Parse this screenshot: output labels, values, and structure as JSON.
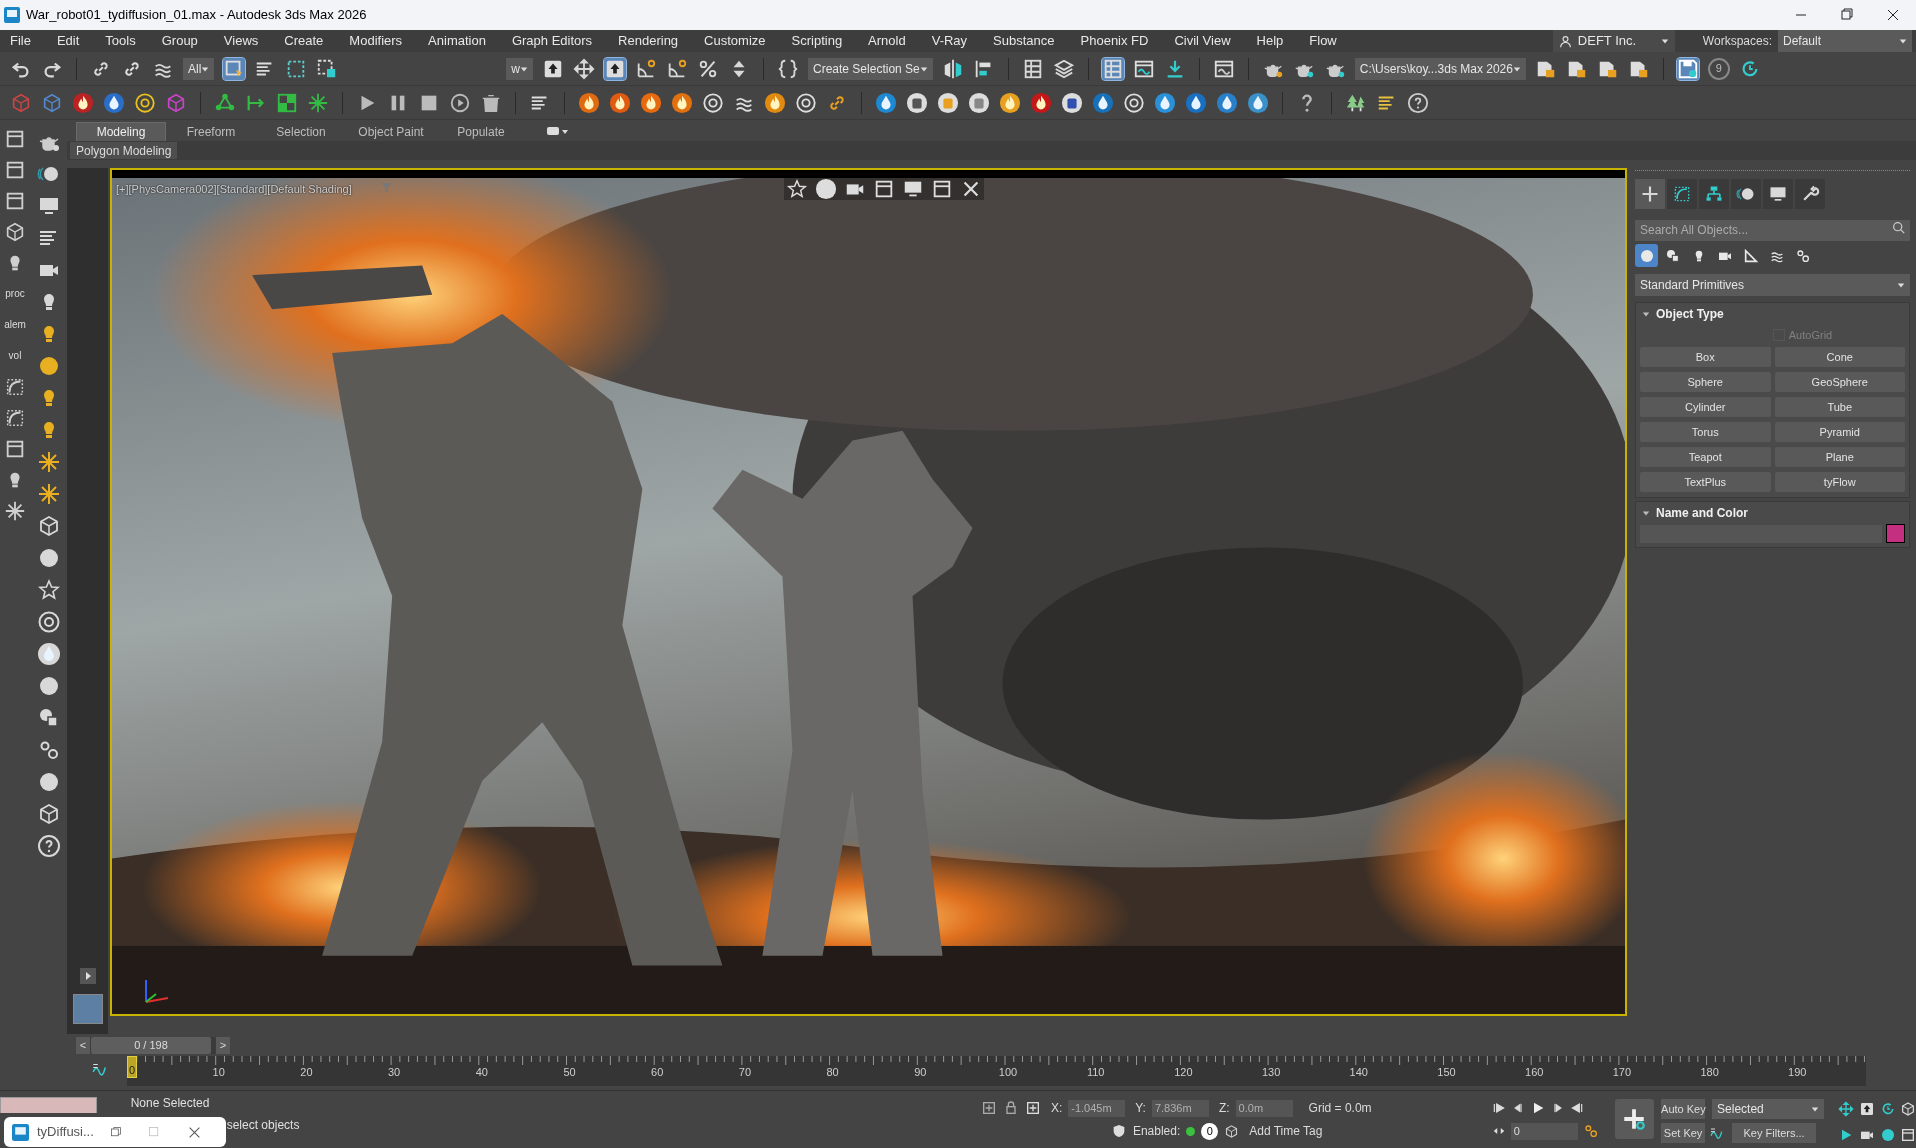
{
  "window": {
    "title": "War_robot01_tydiffusion_01.max - Autodesk 3ds Max 2026"
  },
  "menu": [
    "File",
    "Edit",
    "Tools",
    "Group",
    "Views",
    "Create",
    "Modifiers",
    "Animation",
    "Graph Editors",
    "Rendering",
    "Customize",
    "Scripting",
    "Arnold",
    "V-Ray",
    "Substance",
    "Phoenix FD",
    "Civil View",
    "Help",
    "Flow"
  ],
  "account": "DEFT Inc.",
  "workspaces": {
    "label": "Workspaces:",
    "value": "Default"
  },
  "toolbar": {
    "selection_filter": "All",
    "view_dropdown": "w",
    "selection_set": "Create Selection Se",
    "project_folder": "C:\\Users\\koy...3ds Max 2026",
    "backup_count": "9"
  },
  "left_toolbar": {
    "labels": [
      "proc",
      "alem",
      "vol"
    ]
  },
  "ribbon": {
    "tabs": [
      {
        "label": "Modeling",
        "selected": true
      },
      {
        "label": "Freeform",
        "selected": false
      },
      {
        "label": "Selection",
        "selected": false
      },
      {
        "label": "Object Paint",
        "selected": false
      },
      {
        "label": "Populate",
        "selected": false
      }
    ],
    "panel": "Polygon Modeling"
  },
  "viewport": {
    "label": "[+][PhysCamera002][Standard][Default Shading]",
    "active": true,
    "kind": "picture"
  },
  "command_panel": {
    "tabs": [
      {
        "selected": true
      },
      {
        "selected": false
      },
      {
        "selected": false
      },
      {
        "selected": false
      },
      {
        "selected": false
      },
      {
        "selected": false
      }
    ],
    "search": {
      "placeholder": "Search All Objects..."
    },
    "categories": [
      {
        "selected": true
      },
      {
        "selected": false
      },
      {
        "selected": false
      },
      {
        "selected": false
      },
      {
        "selected": false
      },
      {
        "selected": false
      },
      {
        "selected": false
      }
    ],
    "dropdown": "Standard Primitives",
    "object_type": {
      "title": "Object Type",
      "expanded": true,
      "autogrid": {
        "label": "AutoGrid",
        "checked": false,
        "disabled": true
      },
      "buttons": [
        "Box",
        "Cone",
        "Sphere",
        "GeoSphere",
        "Cylinder",
        "Tube",
        "Torus",
        "Pyramid",
        "Teapot",
        "Plane",
        "TextPlus",
        "tyFlow"
      ]
    },
    "name_and_color": {
      "title": "Name and Color",
      "expanded": true,
      "color": "#c4307f"
    }
  },
  "time_slider": {
    "previous": "<",
    "label": "0 / 198",
    "next": ">",
    "level": 0
  },
  "timeline": {
    "ticks": [
      "0",
      "10",
      "20",
      "30",
      "40",
      "50",
      "60",
      "70",
      "80",
      "90",
      "100",
      "110",
      "120",
      "130",
      "140",
      "150",
      "160",
      "170",
      "180",
      "190"
    ]
  },
  "status": {
    "selection": "None Selected",
    "prompt": "select objects",
    "coords": [
      {
        "label": "X:",
        "value": "-1.045m"
      },
      {
        "label": "Y:",
        "value": "7.836m"
      },
      {
        "label": "Z:",
        "value": "0.0m"
      }
    ],
    "grid": "Grid = 0.0m",
    "enabled_label": "Enabled:",
    "enabled": true,
    "enabled_count": "0",
    "time_tag": "Add Time Tag",
    "auto_key": "Auto Key",
    "set_key": "Set Key",
    "key_mode": "Selected",
    "frame": "0",
    "key_filters": "Key Filters..."
  },
  "taskbar_preview": {
    "title": "tyDiffusi..."
  }
}
